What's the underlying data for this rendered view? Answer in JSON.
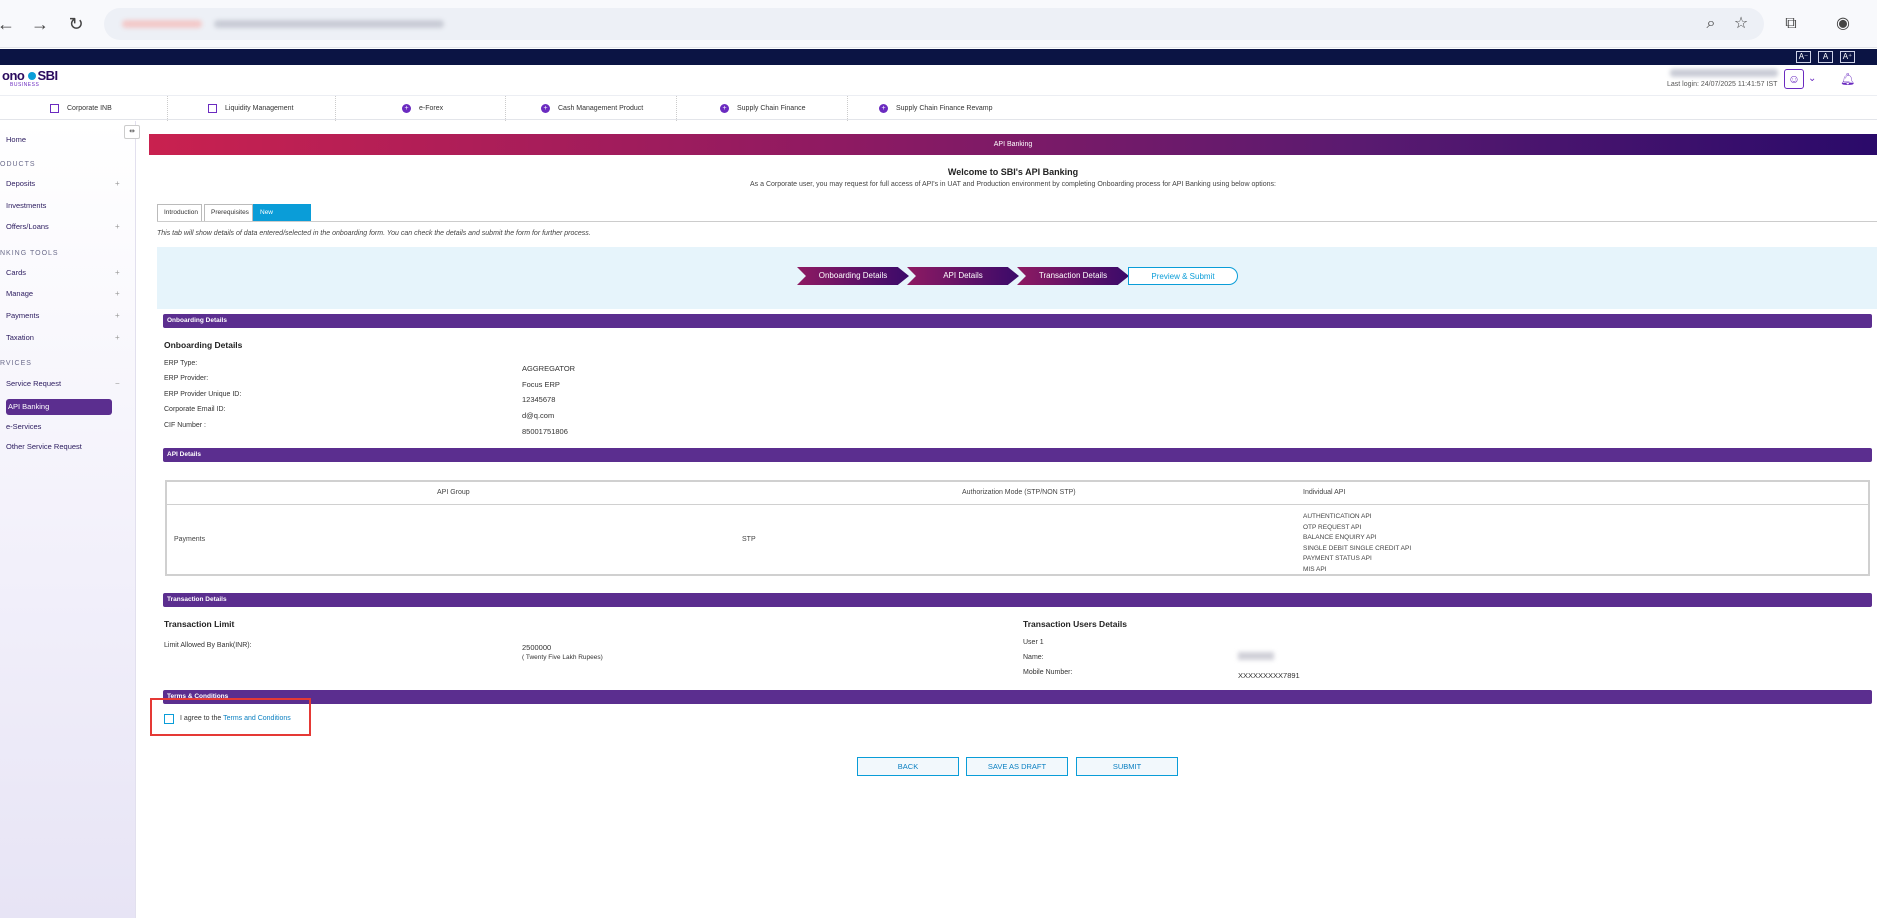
{
  "header": {
    "last_login": "Last login: 24/07/2025 11:41:57 IST",
    "logo": {
      "prefix": "ono",
      "brand": "SBI",
      "tagline": "BUSINESS"
    },
    "font_buttons": [
      "A⁻",
      "A",
      "A⁺"
    ]
  },
  "product_tabs": [
    {
      "label": "Corporate INB",
      "icon": "bank-icon"
    },
    {
      "label": "Liquidity Management",
      "icon": "document-icon"
    },
    {
      "label": "e-Forex",
      "icon": "plus-circle-icon"
    },
    {
      "label": "Cash Management Product",
      "icon": "plus-circle-icon"
    },
    {
      "label": "Supply Chain Finance",
      "icon": "plus-circle-icon"
    },
    {
      "label": "Supply Chain Finance Revamp",
      "icon": "plus-circle-icon"
    }
  ],
  "sidebar": {
    "home": "Home",
    "section_products": "ODUCTS",
    "deposits": "Deposits",
    "investments": "Investments",
    "offers": "Offers/Loans",
    "section_banking": "NKING TOOLS",
    "cards": "Cards",
    "manage": "Manage",
    "payments": "Payments",
    "taxation": "Taxation",
    "section_services": "RVICES",
    "service_request": "Service Request",
    "api_banking": "API Banking",
    "eservices": "e-Services",
    "other_service": "Other Service Request"
  },
  "page": {
    "title": "API Banking",
    "welcome": "Welcome to SBI's API Banking",
    "welcome_sub": "As a Corporate user, you may request for full access of API's in UAT and Production environment by completing Onboarding process for API Banking using below options:",
    "tabs": [
      "Introduction",
      "Prerequisites",
      "New Application"
    ],
    "tab_note": "This tab will show details of data entered/selected in the onboarding form. You can check the details and submit the form for further process.",
    "steps": [
      "Onboarding Details",
      "API Details",
      "Transaction Details",
      "Preview & Submit"
    ]
  },
  "onboarding": {
    "bar": "Onboarding Details",
    "heading": "Onboarding Details",
    "fields": [
      {
        "label": "ERP Type:",
        "value": "AGGREGATOR"
      },
      {
        "label": "ERP Provider:",
        "value": "Focus ERP"
      },
      {
        "label": "ERP Provider Unique ID:",
        "value": "12345678"
      },
      {
        "label": "Corporate Email ID:",
        "value": "d@q.com"
      },
      {
        "label": "CIF Number :",
        "value": "85001751806"
      }
    ]
  },
  "api_details": {
    "bar": "API Details",
    "headers": [
      "API Group",
      "Authorization Mode (STP/NON STP)",
      "Individual API"
    ],
    "row": {
      "group": "Payments",
      "mode": "STP",
      "apis": [
        "AUTHENTICATION API",
        "OTP REQUEST API",
        "BALANCE ENQUIRY API",
        "SINGLE DEBIT SINGLE CREDIT API",
        "PAYMENT STATUS API",
        "MIS API"
      ]
    }
  },
  "transaction": {
    "bar": "Transaction Details",
    "limit_heading": "Transaction Limit",
    "limit_label": "Limit Allowed By Bank(INR):",
    "limit_value": "2500000",
    "limit_words": "( Twenty Five Lakh Rupees)",
    "users_heading": "Transaction Users Details",
    "user_label": "User 1",
    "name_label": "Name:",
    "mobile_label": "Mobile Number:",
    "mobile_value": "XXXXXXXXX7891"
  },
  "terms": {
    "bar": "Terms & Conditions",
    "text": "I agree to the",
    "link": "Terms and Conditions"
  },
  "actions": {
    "back": "BACK",
    "draft": "SAVE AS DRAFT",
    "submit": "SUBMIT"
  },
  "colors": {
    "accent": "#0a9dd8",
    "brand_purple": "#5b2e8f",
    "navy": "#0b1444",
    "highlight_red": "#e53935"
  }
}
